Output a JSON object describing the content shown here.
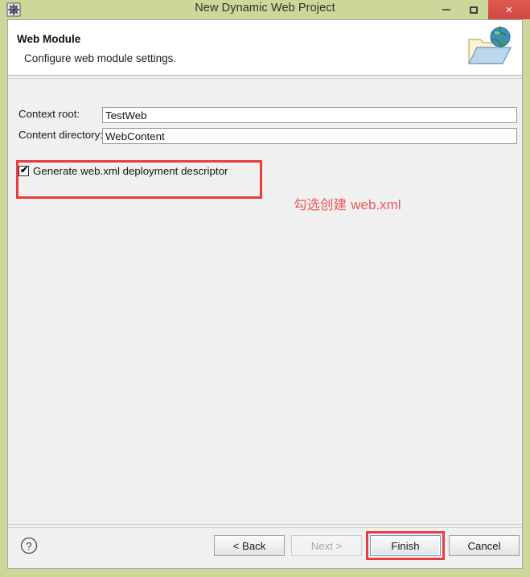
{
  "window": {
    "title": "New Dynamic Web Project",
    "app_icon": "eclipse-gear-icon",
    "controls": {
      "minimize": "–",
      "maximize": "□",
      "close": "×"
    },
    "colors": {
      "titlebar": "#cdd79a",
      "close_button": "#d9534f",
      "body": "#f0f0f0",
      "annotation_red": "#ea3d3d",
      "focus_blue": "#5a9fd4"
    }
  },
  "header": {
    "title": "Web Module",
    "description": "Configure web module settings.",
    "icon": "web-folder-globe-icon"
  },
  "form": {
    "fields": [
      {
        "label": "Context root:",
        "value": "TestWeb",
        "placeholder": ""
      },
      {
        "label": "Content directory:",
        "value": "WebContent",
        "placeholder": ""
      }
    ],
    "checkbox": {
      "label": "Generate web.xml deployment descriptor",
      "checked": true,
      "check_glyph": "✔"
    }
  },
  "annotations": {
    "note_text_cjk": "勾选创建 ",
    "note_text_ascii": "web.xml",
    "boxed_elements": [
      "generate-webxml-checkbox",
      "finish-button"
    ]
  },
  "footer": {
    "help_icon": "question-mark-icon",
    "help_glyph": "?",
    "buttons": [
      {
        "id": "back",
        "label": "< Back",
        "enabled": true,
        "focused": false
      },
      {
        "id": "next",
        "label": "Next >",
        "enabled": false,
        "focused": false
      },
      {
        "id": "finish",
        "label": "Finish",
        "enabled": true,
        "focused": true
      },
      {
        "id": "cancel",
        "label": "Cancel",
        "enabled": true,
        "focused": false
      }
    ]
  }
}
